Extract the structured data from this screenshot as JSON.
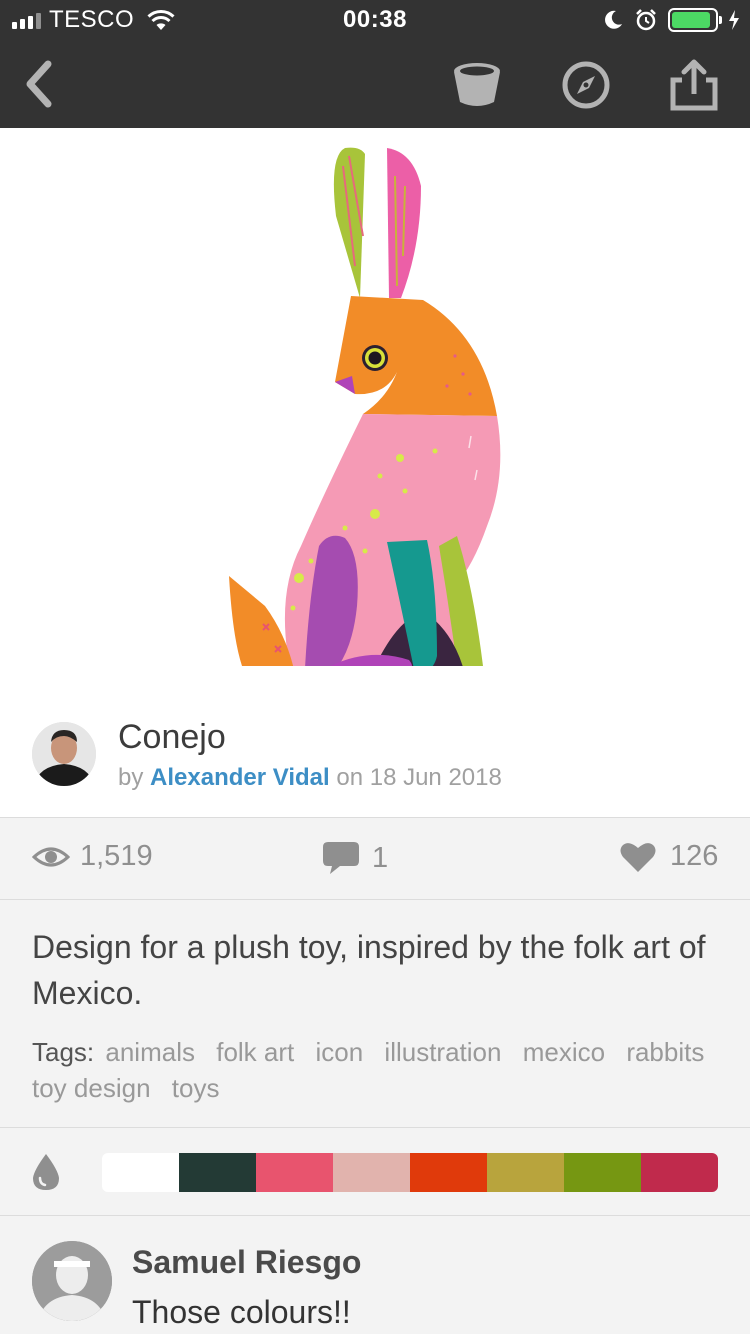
{
  "status_bar": {
    "carrier": "TESCO",
    "time": "00:38",
    "battery_level": 0.9,
    "battery_color": "#4cd964"
  },
  "nav": {
    "back_icon": "chevron-left-icon",
    "actions": [
      "bucket-icon",
      "compass-icon",
      "share-icon"
    ]
  },
  "shot": {
    "title": "Conejo",
    "by_label": "by",
    "author": "Alexander Vidal",
    "on_label": "on",
    "date": "18 Jun 2018"
  },
  "stats": {
    "views": "1,519",
    "comments": "1",
    "likes": "126"
  },
  "description": "Design for a plush toy, inspired by the folk art of Mexico.",
  "tags": {
    "label": "Tags:",
    "items": [
      "animals",
      "folk art",
      "icon",
      "illustration",
      "mexico",
      "rabbits",
      "toy design",
      "toys"
    ]
  },
  "palette": [
    "#ffffff",
    "#233a35",
    "#e8546e",
    "#e1b3ad",
    "#e03a0b",
    "#b8a43d",
    "#769712",
    "#c02a4c"
  ],
  "comment": {
    "name": "Samuel Riesgo",
    "text": "Those colours!!"
  },
  "colors": {
    "bar_bg": "#333333",
    "accent_link": "#3d8ec5"
  }
}
